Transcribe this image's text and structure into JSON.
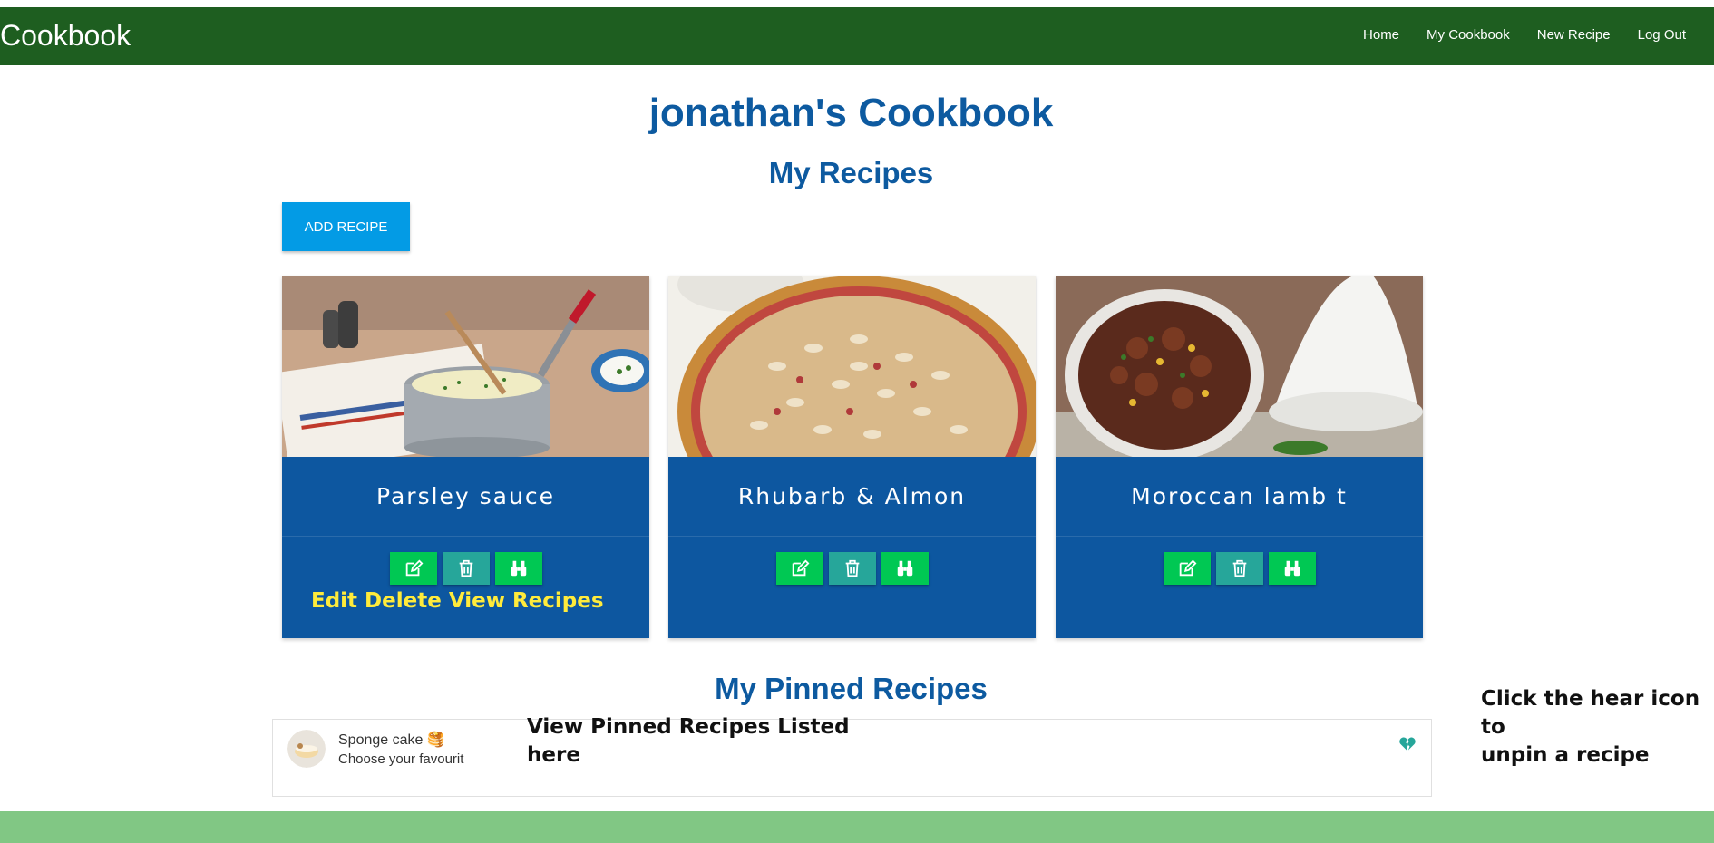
{
  "navbar": {
    "brand": "Cookbook",
    "links": [
      "Home",
      "My Cookbook",
      "New Recipe",
      "Log Out"
    ]
  },
  "page": {
    "title": "jonathan's Cookbook",
    "my_recipes_heading": "My Recipes",
    "add_recipe_label": "ADD RECIPE",
    "pinned_heading": "My Pinned Recipes"
  },
  "recipes": [
    {
      "title": "Parsley sauce"
    },
    {
      "title": "Rhubarb & Almon"
    },
    {
      "title": "Moroccan lamb t"
    }
  ],
  "card_actions": {
    "edit_icon": "edit-icon",
    "delete_icon": "trash-icon",
    "view_icon": "binoculars-icon"
  },
  "pinned": {
    "title": "Sponge cake 🥞",
    "subtitle": "Choose your favourit",
    "unpin_icon": "broken-heart-icon"
  },
  "annotations": {
    "card_actions_note": "Edit Delete View Recipes",
    "pinned_note": "View Pinned Recipes Listed\nhere",
    "unpin_note": "Click the hear icon to\nunpin a recipe"
  },
  "colors": {
    "navbar": "#1e5e20",
    "card": "#0d57a0",
    "heading": "#0d5aa0",
    "add_button": "#039be5",
    "action_green": "#00c853",
    "action_teal": "#26a69a",
    "footer": "#81c784",
    "annotation_yellow": "#ffeb3b"
  }
}
